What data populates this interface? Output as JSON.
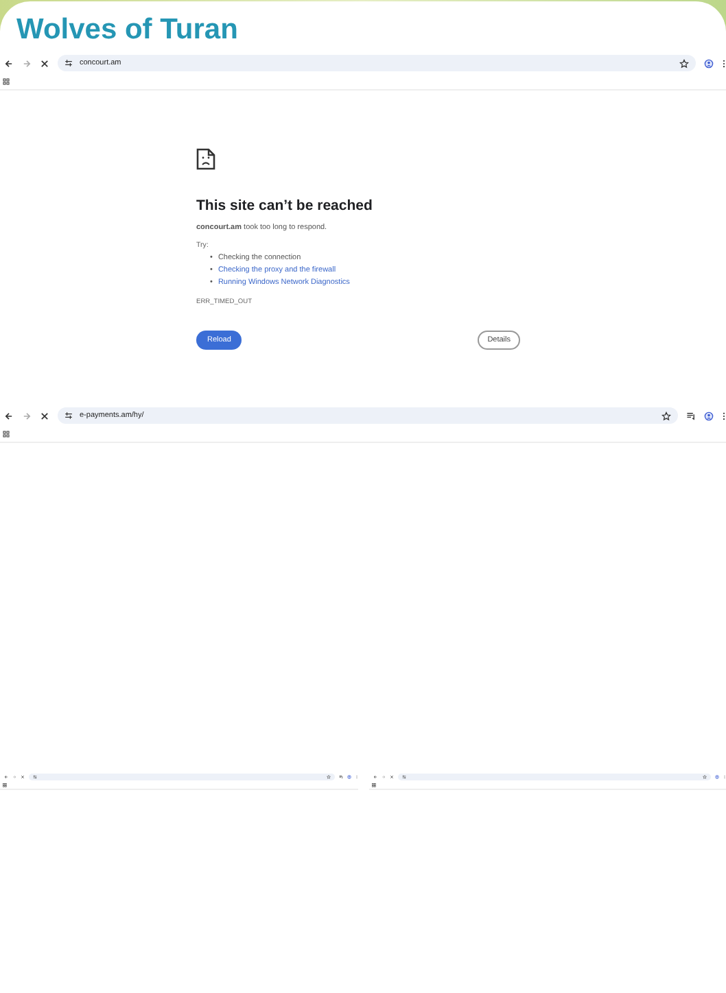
{
  "title": "Wolves of Turan",
  "browsers": [
    {
      "url": "concourt.am",
      "extensions": false
    },
    {
      "url": "e-payments.am/hy/",
      "extensions": true
    }
  ],
  "error": {
    "heading": "This site can’t be reached",
    "message": "**concourt.am** took too long to respond.",
    "try_label": "Try:",
    "suggestions": [
      {
        "marker": "•",
        "text": "Checking the connection",
        "link": false
      },
      {
        "marker": "•",
        "text": "Checking the proxy and the firewall",
        "link": true
      },
      {
        "marker": "•",
        "text": "Running Windows Network Diagnostics",
        "link": true
      }
    ],
    "code": "ERR_TIMED_OUT",
    "reload": "Reload",
    "details": "Details"
  },
  "mini_browsers": [
    {
      "extensions": true
    },
    {
      "extensions": false
    }
  ]
}
